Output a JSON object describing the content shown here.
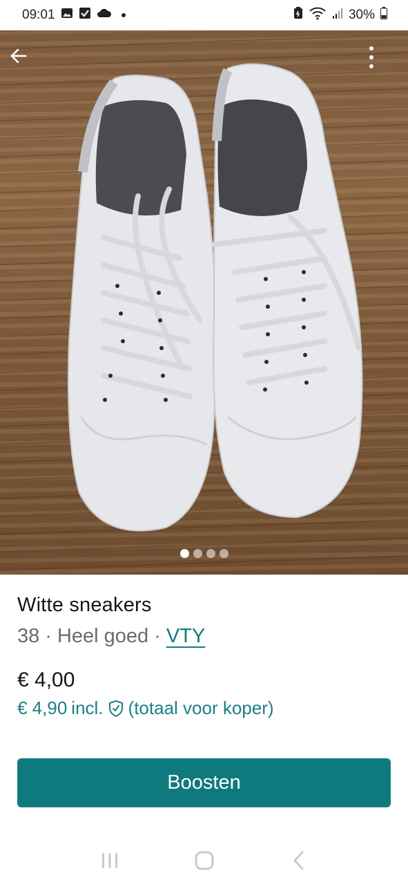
{
  "status_bar": {
    "time": "09:01",
    "battery": "30%",
    "icons": [
      "image-icon",
      "checkbox-icon",
      "cloud-icon",
      "dot-icon",
      "battery-saver-icon",
      "wifi-icon",
      "signal-icon",
      "battery-icon"
    ]
  },
  "photo": {
    "image_count": 4,
    "active_index": 0,
    "back_icon": "arrow-left-icon",
    "more_icon": "more-vertical-icon"
  },
  "item": {
    "title": "Witte sneakers",
    "size": "38",
    "separator": "·",
    "condition": "Heel goed",
    "brand": "VTY",
    "price": "€ 4,00",
    "price_incl_amount": "€ 4,90",
    "price_incl_label": "incl.",
    "price_incl_note": "(totaal voor koper)"
  },
  "actions": {
    "boost_label": "Boosten"
  },
  "nav_bar": {
    "icons": [
      "recent-apps-icon",
      "home-icon",
      "back-icon"
    ]
  },
  "colors": {
    "accent": "#0f7a7e",
    "accent_text": "#1c7f85",
    "meta_text": "#6b6b6b"
  }
}
